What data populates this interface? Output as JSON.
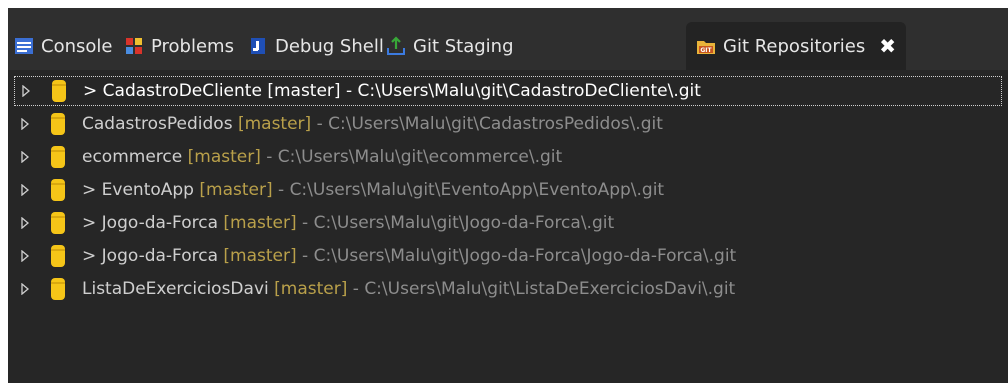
{
  "tabs": [
    {
      "label": "Console",
      "icon": "console-icon"
    },
    {
      "label": "Problems",
      "icon": "problems-icon"
    },
    {
      "label": "Debug Shell",
      "icon": "debug-shell-icon"
    },
    {
      "label": "Git Staging",
      "icon": "git-staging-icon"
    },
    {
      "label": "Git Repositories",
      "icon": "git-repositories-icon",
      "active": true
    }
  ],
  "close_glyph": "✖",
  "repositories": [
    {
      "prefix": "> ",
      "name": "CadastroDeCliente",
      "branch": "[master]",
      "sep": " - ",
      "path": "C:\\Users\\Malu\\git\\CadastroDeCliente\\.git",
      "selected": true
    },
    {
      "prefix": "",
      "name": "CadastrosPedidos",
      "branch": "[master]",
      "sep": " - ",
      "path": "C:\\Users\\Malu\\git\\CadastrosPedidos\\.git"
    },
    {
      "prefix": "",
      "name": "ecommerce",
      "branch": "[master]",
      "sep": " - ",
      "path": "C:\\Users\\Malu\\git\\ecommerce\\.git"
    },
    {
      "prefix": "> ",
      "name": "EventoApp",
      "branch": "[master]",
      "sep": " - ",
      "path": "C:\\Users\\Malu\\git\\EventoApp\\EventoApp\\.git"
    },
    {
      "prefix": "> ",
      "name": "Jogo-da-Forca",
      "branch": "[master]",
      "sep": " - ",
      "path": "C:\\Users\\Malu\\git\\Jogo-da-Forca\\.git"
    },
    {
      "prefix": "> ",
      "name": "Jogo-da-Forca",
      "branch": "[master]",
      "sep": " - ",
      "path": "C:\\Users\\Malu\\git\\Jogo-da-Forca\\Jogo-da-Forca\\.git"
    },
    {
      "prefix": "",
      "name": "ListaDeExerciciosDavi",
      "branch": "[master]",
      "sep": " - ",
      "path": "C:\\Users\\Malu\\git\\ListaDeExerciciosDavi\\.git"
    }
  ],
  "colors": {
    "panel_bg": "#262626",
    "tabbar_bg": "#2f2f2f",
    "branch": "#b9a04a",
    "path": "#8d8d8d",
    "repo_icon": "#f5c518"
  }
}
